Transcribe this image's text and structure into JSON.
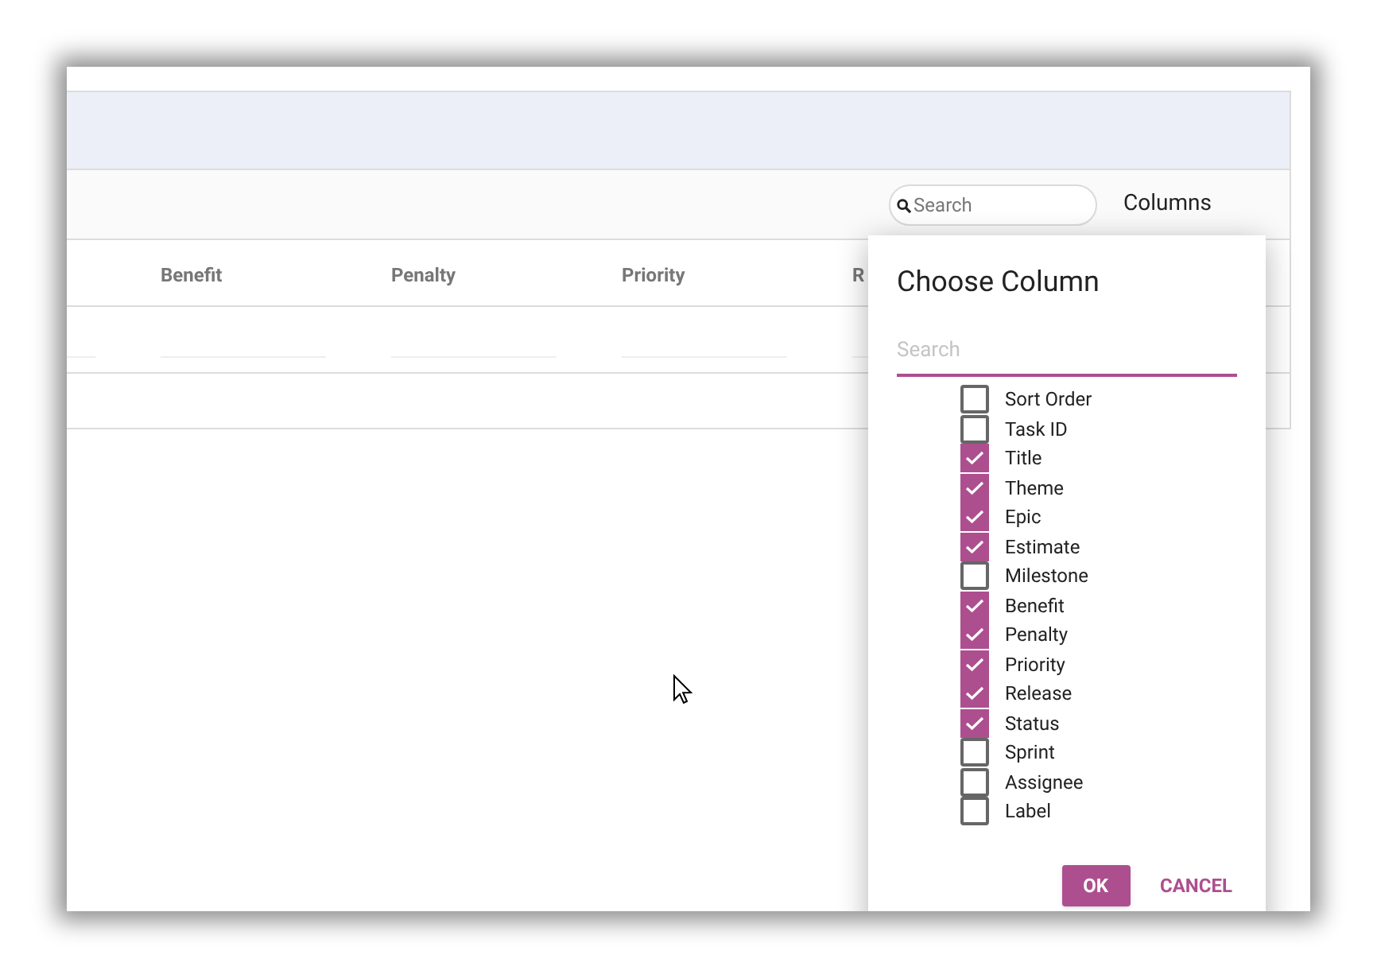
{
  "toolbar": {
    "search": {
      "placeholder": "Search"
    },
    "columns_button": "Columns"
  },
  "table": {
    "columns": [
      {
        "label": "Benefit"
      },
      {
        "label": "Penalty"
      },
      {
        "label": "Priority"
      },
      {
        "label": "R"
      }
    ]
  },
  "dialog": {
    "title": "Choose Column",
    "search": {
      "placeholder": "Search"
    },
    "options": [
      {
        "label": "Sort Order",
        "checked": false
      },
      {
        "label": "Task ID",
        "checked": false
      },
      {
        "label": "Title",
        "checked": true
      },
      {
        "label": "Theme",
        "checked": true
      },
      {
        "label": "Epic",
        "checked": true
      },
      {
        "label": "Estimate",
        "checked": true
      },
      {
        "label": "Milestone",
        "checked": false
      },
      {
        "label": "Benefit",
        "checked": true
      },
      {
        "label": "Penalty",
        "checked": true
      },
      {
        "label": "Priority",
        "checked": true
      },
      {
        "label": "Release",
        "checked": true
      },
      {
        "label": "Status",
        "checked": true
      },
      {
        "label": "Sprint",
        "checked": false
      },
      {
        "label": "Assignee",
        "checked": false
      },
      {
        "label": "Label",
        "checked": false
      }
    ],
    "ok": "OK",
    "cancel": "CANCEL"
  }
}
